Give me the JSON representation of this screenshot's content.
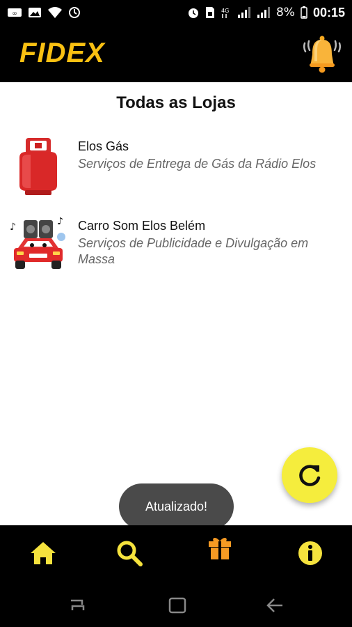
{
  "status_bar": {
    "battery": "8%",
    "time": "00:15",
    "left_icons": [
      "link-icon",
      "image-icon",
      "wifi-icon",
      "sync-icon"
    ],
    "right_icons": [
      "alarm-icon",
      "sim-icon",
      "4g-icon",
      "signal-icon",
      "signal-icon",
      "battery-icon"
    ]
  },
  "app_bar": {
    "logo": "FIDEX",
    "notification_icon": "bell-icon"
  },
  "main": {
    "title": "Todas as Lojas",
    "stores": [
      {
        "name": "Elos Gás",
        "description": "Serviços de Entrega de Gás da Rádio Elos",
        "icon": "gas-cylinder-icon"
      },
      {
        "name": "Carro Som Elos Belém",
        "description": "Serviços de Publicidade e Divulgação em Massa",
        "icon": "sound-car-icon"
      }
    ]
  },
  "fab": {
    "icon": "refresh-icon"
  },
  "toast": {
    "text": "Atualizado!"
  },
  "bottom_nav": {
    "items": [
      {
        "icon": "home-icon",
        "color": "#f5e23d"
      },
      {
        "icon": "search-icon",
        "color": "#f5e23d"
      },
      {
        "icon": "gift-icon",
        "color": "#f59a23"
      },
      {
        "icon": "info-icon",
        "color": "#f5e23d"
      }
    ]
  },
  "colors": {
    "brand_yellow": "#f9c012",
    "fab_yellow": "#f5ed3d",
    "toast_bg": "#4a4a4a"
  }
}
